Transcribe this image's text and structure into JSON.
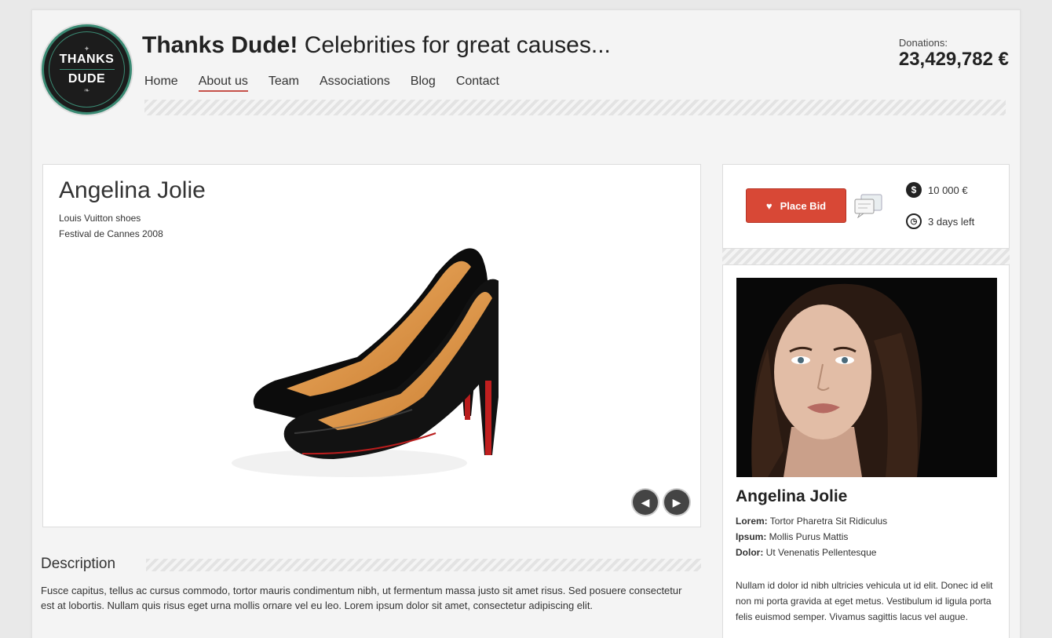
{
  "brand": {
    "logo_line1": "THANKS",
    "logo_line2": "DUDE",
    "title_bold": "Thanks Dude!",
    "title_rest": " Celebrities for great causes..."
  },
  "nav": [
    {
      "label": "Home",
      "active": false
    },
    {
      "label": "About us",
      "active": true
    },
    {
      "label": "Team",
      "active": false
    },
    {
      "label": "Associations",
      "active": false
    },
    {
      "label": "Blog",
      "active": false
    },
    {
      "label": "Contact",
      "active": false
    }
  ],
  "donations": {
    "label": "Donations:",
    "amount": "23,429,782 €"
  },
  "product": {
    "celebrity": "Angelina Jolie",
    "item": "Louis Vuitton shoes",
    "event": "Festival de Cannes 2008"
  },
  "slider": {
    "prev_icon": "chevron-left-icon",
    "next_icon": "chevron-right-icon"
  },
  "description": {
    "heading": "Description",
    "text": "Fusce capitus, tellus ac cursus commodo, tortor mauris condimentum nibh, ut fermentum massa justo sit amet risus. Sed posuere consectetur est at lobortis. Nullam quis risus eget urna mollis ornare vel eu leo. Lorem ipsum dolor sit amet, consectetur adipiscing elit."
  },
  "bid": {
    "button_label": "Place Bid",
    "price": "10 000 €",
    "time_left": "3 days left"
  },
  "celebrity": {
    "name": "Angelina Jolie",
    "fact1_key": "Lorem:",
    "fact1_val": " Tortor Pharetra Sit Ridiculus",
    "fact2_key": "Ipsum:",
    "fact2_val": " Mollis Purus Mattis",
    "fact3_key": "Dolor:",
    "fact3_val": " Ut Venenatis Pellentesque",
    "bio": "Nullam id dolor id nibh ultricies vehicula ut id elit. Donec id elit non mi porta gravida at eget metus. Vestibulum id ligula porta felis euismod semper. Vivamus sagittis lacus vel augue."
  },
  "colors": {
    "accent": "#d84836",
    "nav_underline": "#c6524a",
    "logo_ring": "#3a8a73"
  }
}
